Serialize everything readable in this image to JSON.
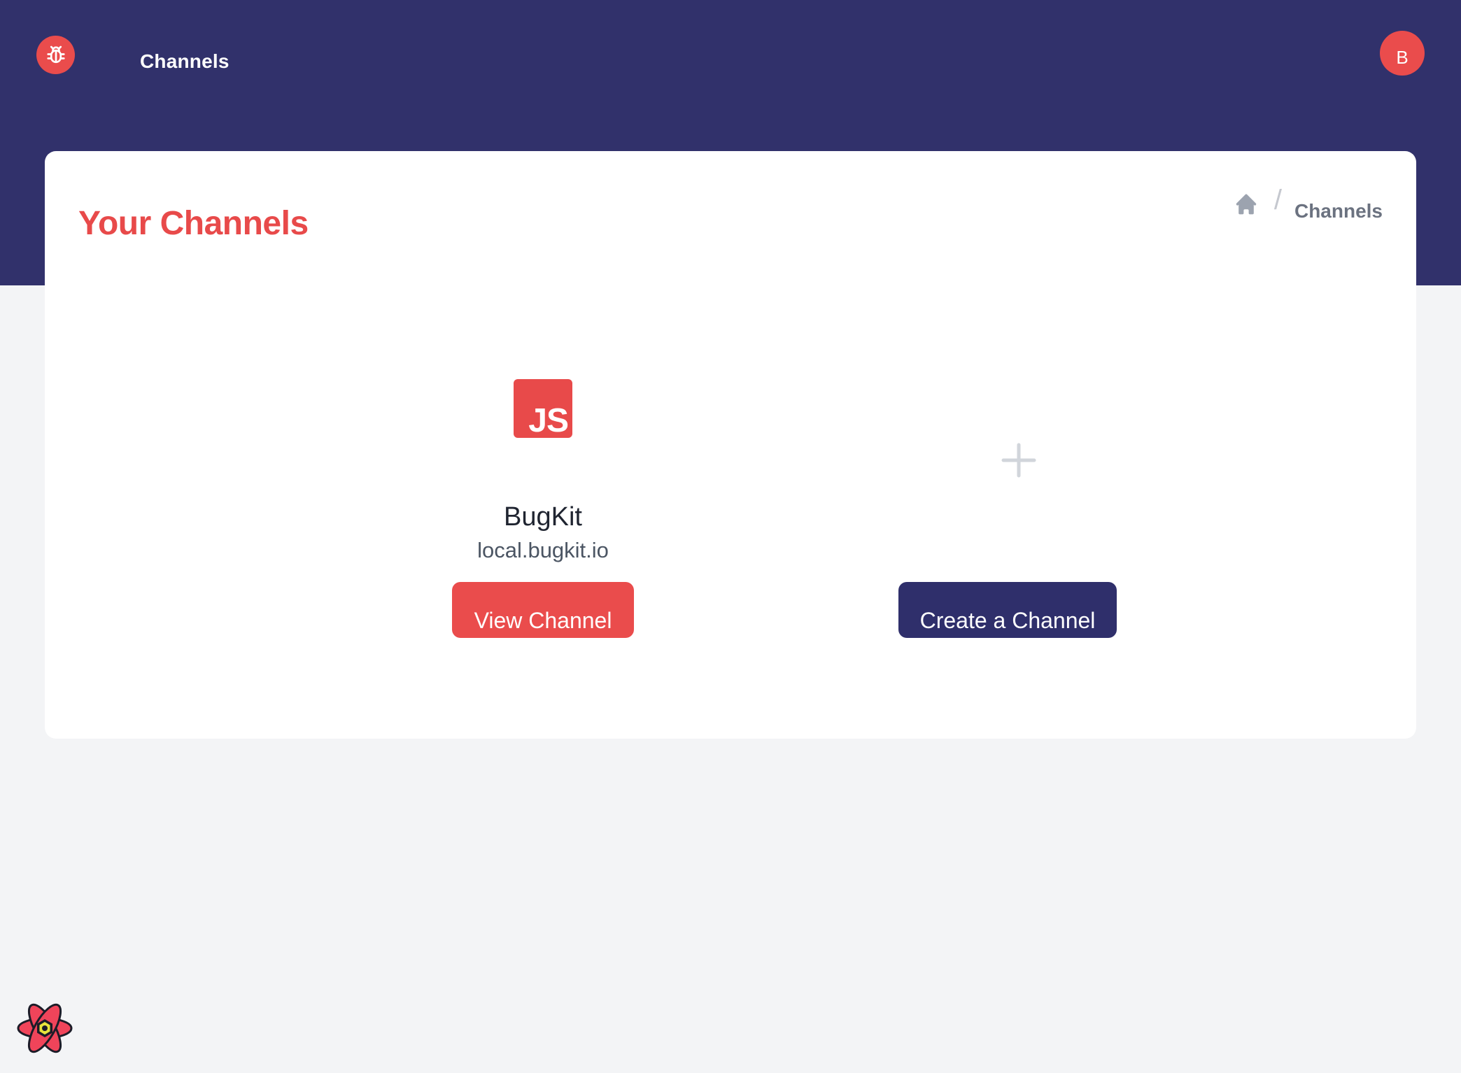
{
  "header": {
    "logo_icon": "bug-icon",
    "nav": [
      {
        "label": "Channels"
      }
    ],
    "avatar_initial": "B"
  },
  "page": {
    "title": "Your Channels",
    "breadcrumb": {
      "home_icon": "home-icon",
      "separator": "/",
      "current": "Channels"
    }
  },
  "channels": [
    {
      "icon_text": "JS",
      "name": "BugKit",
      "domain": "local.bugkit.io",
      "button_label": "View Channel"
    }
  ],
  "create_tile": {
    "icon": "plus-icon",
    "button_label": "Create a Channel"
  },
  "devtools_icon": "react-devtools-icon",
  "colors": {
    "header_bg": "#31316b",
    "accent_red": "#ea4c4c",
    "navy_button": "#2f2f6b",
    "page_bg": "#f3f4f6"
  }
}
